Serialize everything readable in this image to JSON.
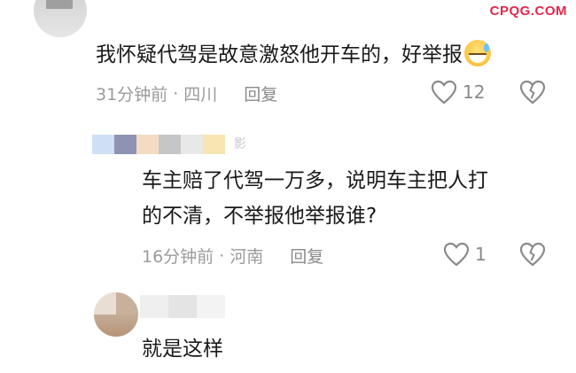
{
  "watermark": "CPQG.COM",
  "comments": [
    {
      "text": "我怀疑代驾是故意激怒他开车的，好举报",
      "emoji": "grinning-sweat-emoji",
      "time": "31分钟前",
      "location": "四川",
      "reply_label": "回复",
      "like_count": "12"
    },
    {
      "name_partial": "影",
      "text_line1": "车主赔了代驾一万多，说明车主把人打",
      "text_line2": "的不清，不举报他举报谁?",
      "time": "16分钟前",
      "location": "河南",
      "reply_label": "回复",
      "like_count": "1"
    },
    {
      "text": "就是这样"
    }
  ],
  "colors": {
    "accent_watermark": "#e0294c",
    "meta_gray": "#9b9b9b",
    "text": "#1a1a1a"
  }
}
